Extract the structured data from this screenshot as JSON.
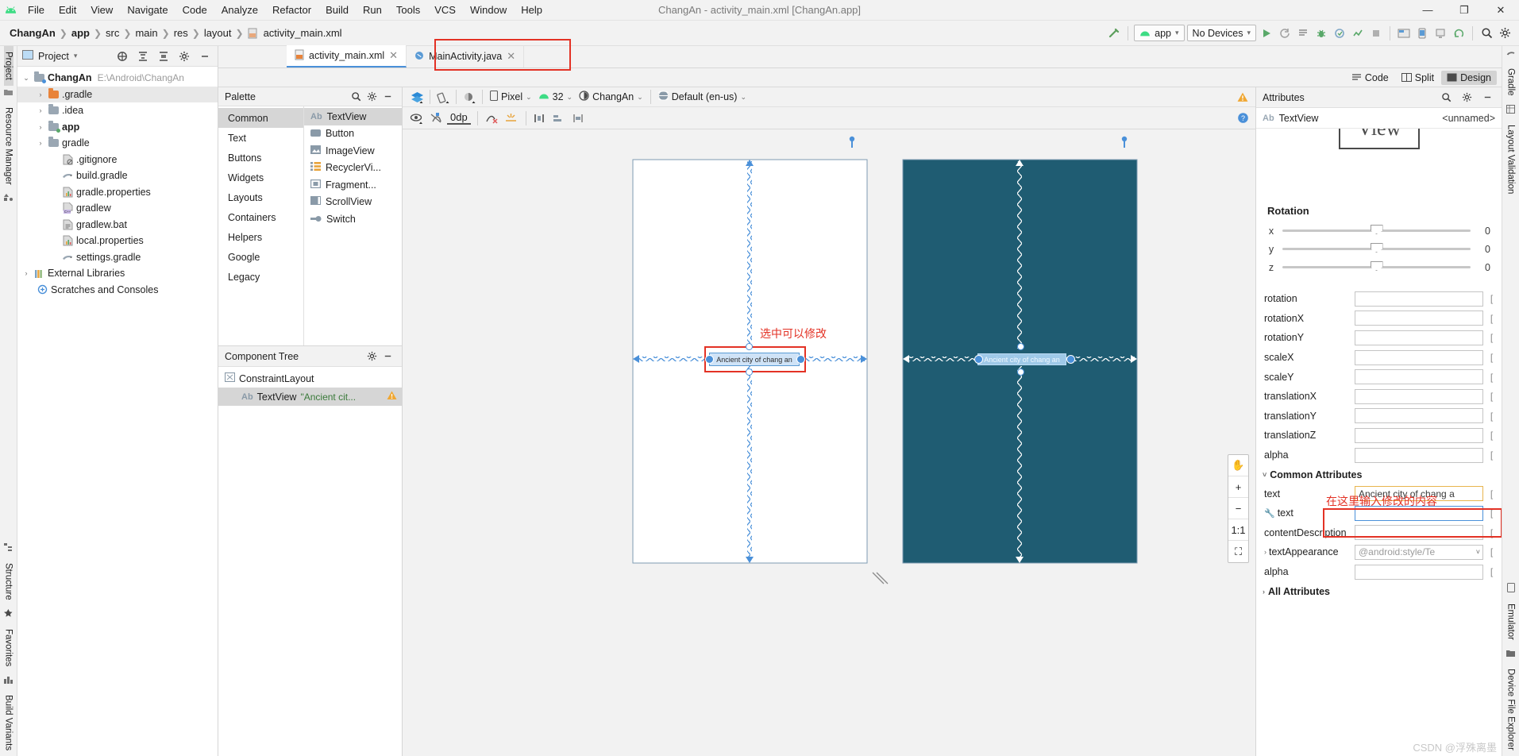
{
  "window": {
    "title": "ChangAn - activity_main.xml [ChangAn.app]",
    "minimize": "—",
    "maximize": "❐",
    "close": "✕"
  },
  "menu": [
    "File",
    "Edit",
    "View",
    "Navigate",
    "Code",
    "Analyze",
    "Refactor",
    "Build",
    "Run",
    "Tools",
    "VCS",
    "Window",
    "Help"
  ],
  "breadcrumb": [
    "ChangAn",
    "app",
    "src",
    "main",
    "res",
    "layout",
    "activity_main.xml"
  ],
  "toolbar": {
    "module_selector": "app",
    "device_selector": "No Devices",
    "chevron": "▾"
  },
  "left_rail": {
    "top": [
      "Project",
      "Resource Manager"
    ],
    "bottom": [
      "Structure",
      "Favorites",
      "Build Variants"
    ]
  },
  "right_rail": {
    "top": [
      "Gradle",
      "Layout Validation"
    ],
    "bottom": [
      "Emulator",
      "Device File Explorer"
    ]
  },
  "project_panel": {
    "title": "Project",
    "chevron": "▾",
    "tree": [
      {
        "label": "ChangAn",
        "path": "E:\\Android\\ChangAn",
        "arrow": "⌄",
        "icon": "module-folder",
        "depth": 0,
        "bold": true
      },
      {
        "label": ".gradle",
        "arrow": "›",
        "icon": "folder-orange",
        "depth": 1,
        "selected": true
      },
      {
        "label": ".idea",
        "arrow": "›",
        "icon": "folder-grey",
        "depth": 1
      },
      {
        "label": "app",
        "arrow": "›",
        "icon": "folder-module",
        "depth": 1,
        "bold": true
      },
      {
        "label": "gradle",
        "arrow": "›",
        "icon": "folder-grey",
        "depth": 1
      },
      {
        "label": ".gitignore",
        "icon": "file-ignore",
        "depth": 2
      },
      {
        "label": "build.gradle",
        "icon": "file-gradle",
        "depth": 2
      },
      {
        "label": "gradle.properties",
        "icon": "file-properties",
        "depth": 2
      },
      {
        "label": "gradlew",
        "icon": "file-script",
        "depth": 2
      },
      {
        "label": "gradlew.bat",
        "icon": "file-bat",
        "depth": 2
      },
      {
        "label": "local.properties",
        "icon": "file-properties",
        "depth": 2
      },
      {
        "label": "settings.gradle",
        "icon": "file-gradle",
        "depth": 2
      },
      {
        "label": "External Libraries",
        "arrow": "›",
        "icon": "library",
        "depth": 0
      },
      {
        "label": "Scratches and Consoles",
        "icon": "scratches",
        "depth": 1
      }
    ]
  },
  "editor_tabs": [
    {
      "label": "activity_main.xml",
      "icon": "layout-file-icon",
      "active": true,
      "close": "✕"
    },
    {
      "label": "MainActivity.java",
      "icon": "java-file-icon",
      "active": false,
      "close": "✕"
    }
  ],
  "view_modes": [
    {
      "label": "Code",
      "active": false
    },
    {
      "label": "Split",
      "active": false
    },
    {
      "label": "Design",
      "active": true
    }
  ],
  "palette": {
    "title": "Palette",
    "categories": [
      "Common",
      "Text",
      "Buttons",
      "Widgets",
      "Layouts",
      "Containers",
      "Helpers",
      "Google",
      "Legacy"
    ],
    "selected_category": "Common",
    "items": [
      {
        "label": "TextView",
        "icon": "textview-icon",
        "selected": true
      },
      {
        "label": "Button",
        "icon": "button-icon"
      },
      {
        "label": "ImageView",
        "icon": "imageview-icon"
      },
      {
        "label": "RecyclerVi...",
        "icon": "recyclerview-icon"
      },
      {
        "label": "Fragment...",
        "icon": "fragment-icon"
      },
      {
        "label": "ScrollView",
        "icon": "scrollview-icon"
      },
      {
        "label": "Switch",
        "icon": "switch-icon"
      }
    ]
  },
  "component_tree": {
    "title": "Component Tree",
    "rows": [
      {
        "label": "ConstraintLayout",
        "icon": "constraintlayout-icon",
        "depth": 0,
        "selected": false
      },
      {
        "label": "TextView",
        "icon": "textview-icon",
        "value": "\"Ancient cit...",
        "warning": true,
        "depth": 1,
        "selected": true
      }
    ]
  },
  "design_toolbar": {
    "device": "Pixel",
    "api_level": "32",
    "theme": "ChangAn",
    "locale": "Default (en-us)",
    "margin_value": "0dp",
    "chevron": "⌄"
  },
  "canvas": {
    "annotation_select": "选中可以修改",
    "blueprint_label": "Ancient city of chang an",
    "design_label": "Ancient city of chang an",
    "zoom_controls": [
      "✋",
      "+",
      "−",
      "1:1",
      "⛶"
    ]
  },
  "attributes": {
    "title": "Attributes",
    "component_type": "TextView",
    "component_id": "<unnamed>",
    "rotation_section": "Rotation",
    "sliders": [
      {
        "axis": "x",
        "value": "0"
      },
      {
        "axis": "y",
        "value": "0"
      },
      {
        "axis": "z",
        "value": "0"
      }
    ],
    "properties": [
      {
        "name": "rotation",
        "value": ""
      },
      {
        "name": "rotationX",
        "value": ""
      },
      {
        "name": "rotationY",
        "value": ""
      },
      {
        "name": "scaleX",
        "value": ""
      },
      {
        "name": "scaleY",
        "value": ""
      },
      {
        "name": "translationX",
        "value": ""
      },
      {
        "name": "translationY",
        "value": ""
      },
      {
        "name": "translationZ",
        "value": ""
      },
      {
        "name": "alpha",
        "value": ""
      }
    ],
    "common_section": "Common Attributes",
    "common_annotation": "在这里输入修改的内容",
    "common_properties": [
      {
        "name": "text",
        "value": "Ancient city of chang a",
        "highlight": true
      },
      {
        "name": "text",
        "value": "",
        "wrench": true,
        "focused": true
      },
      {
        "name": "contentDescription",
        "value": ""
      },
      {
        "name": "textAppearance",
        "value": "@android:style/Te",
        "expand": true,
        "dropdown": true
      },
      {
        "name": "alpha",
        "value": ""
      }
    ],
    "all_section": "All Attributes",
    "watermark": "CSDN @浮殊离墨"
  },
  "colors": {
    "accent_blue": "#4a90d9",
    "annotation_red": "#e33225",
    "blueprint_teal": "#1f5c72",
    "highlight_orange": "#e8b54d",
    "android_green": "#3ddc84"
  }
}
